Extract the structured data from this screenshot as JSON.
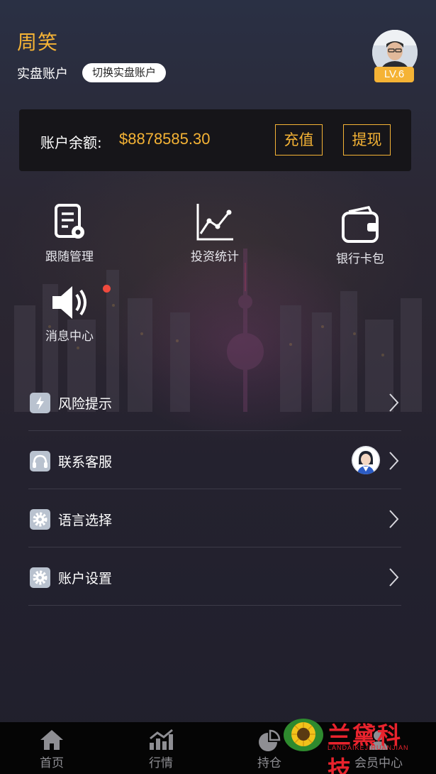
{
  "profile": {
    "name": "周笑",
    "account_type": "实盘账户",
    "switch_label": "切换实盘账户",
    "level": "LV.6"
  },
  "balance": {
    "label": "账户余额:",
    "amount": "$8878585.30",
    "recharge_label": "充值",
    "withdraw_label": "提现"
  },
  "quick_actions": [
    {
      "label": "跟随管理",
      "icon": "document-gear-icon"
    },
    {
      "label": "投资统计",
      "icon": "line-chart-icon"
    },
    {
      "label": "银行卡包",
      "icon": "wallet-icon"
    },
    {
      "label": "消息中心",
      "icon": "speaker-icon",
      "has_notification": true
    }
  ],
  "menu": [
    {
      "label": "风险提示",
      "icon": "lightning-icon"
    },
    {
      "label": "联系客服",
      "icon": "headset-icon"
    },
    {
      "label": "语言选择",
      "icon": "gear-icon"
    },
    {
      "label": "账户设置",
      "icon": "gear-icon"
    }
  ],
  "tabbar": [
    {
      "label": "首页",
      "icon": "home-icon"
    },
    {
      "label": "行情",
      "icon": "chart-icon"
    },
    {
      "label": "持仓",
      "icon": "pie-chart-icon"
    },
    {
      "label": "会员中心",
      "icon": "user-icon"
    }
  ],
  "watermark": {
    "text": "兰黛科技",
    "subtext": "LANDAIKEJIRUANJIAN"
  },
  "colors": {
    "accent": "#f5b335",
    "notification": "#f04a3e",
    "card_bg": "#161519",
    "tabbar_bg": "#050505",
    "watermark": "#e8232d"
  }
}
